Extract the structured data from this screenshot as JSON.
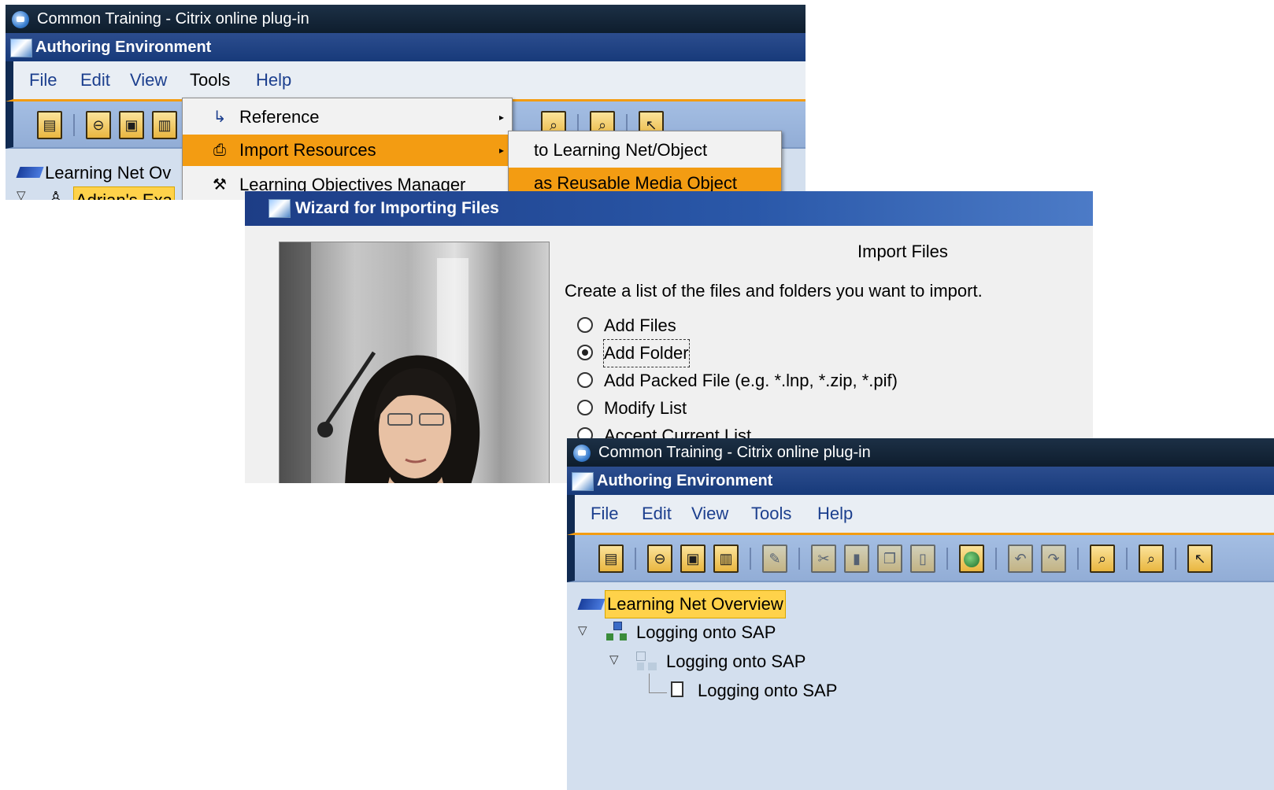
{
  "window1": {
    "citrix_title": "Common Training - Citrix online plug-in",
    "app_title": "Authoring Environment",
    "menu": [
      "File",
      "Edit",
      "View",
      "Tools",
      "Help"
    ],
    "tree_root": "Learning Net Ov",
    "tree_child": "Adrian's Exa"
  },
  "tools_menu": {
    "items": [
      {
        "label": "Reference",
        "icon": "reference-arrow-icon",
        "submenu": true
      },
      {
        "label": "Import Resources",
        "icon": "import-icon",
        "submenu": true,
        "active": true
      },
      {
        "label": "Learning Objectives Manager",
        "icon": "tools-icon"
      }
    ]
  },
  "import_submenu": {
    "items": [
      {
        "label": "to Learning Net/Object"
      },
      {
        "label": "as Reusable Media Object",
        "active": true
      }
    ]
  },
  "wizard": {
    "title": "Wizard for Importing Files",
    "heading": "Import Files",
    "instruction": "Create a list of the files and folders you want to import.",
    "options": [
      {
        "label": "Add Files",
        "checked": false
      },
      {
        "label": "Add Folder",
        "checked": true
      },
      {
        "label": "Add Packed File (e.g. *.lnp, *.zip, *.pif)",
        "checked": false
      },
      {
        "label": "Modify List",
        "checked": false
      },
      {
        "label": "Accept Current List",
        "checked": false
      }
    ]
  },
  "window2": {
    "citrix_title": "Common Training - Citrix online plug-in",
    "app_title": "Authoring Environment",
    "menu": [
      "File",
      "Edit",
      "View",
      "Tools",
      "Help"
    ],
    "tree": [
      {
        "label": "Learning Net Overview",
        "icon": "learning-net-icon",
        "highlighted": true
      },
      {
        "label": "Logging onto SAP",
        "icon": "learning-net-structure-icon"
      },
      {
        "label": "Logging onto SAP",
        "icon": "group-icon"
      },
      {
        "label": "Logging onto SAP",
        "icon": "document-icon"
      }
    ]
  },
  "colors": {
    "accent_orange": "#f39c12",
    "title_navy": "#173a7a",
    "toolbar_blue": "#9bb6de",
    "tree_bg": "#d3dfee"
  }
}
